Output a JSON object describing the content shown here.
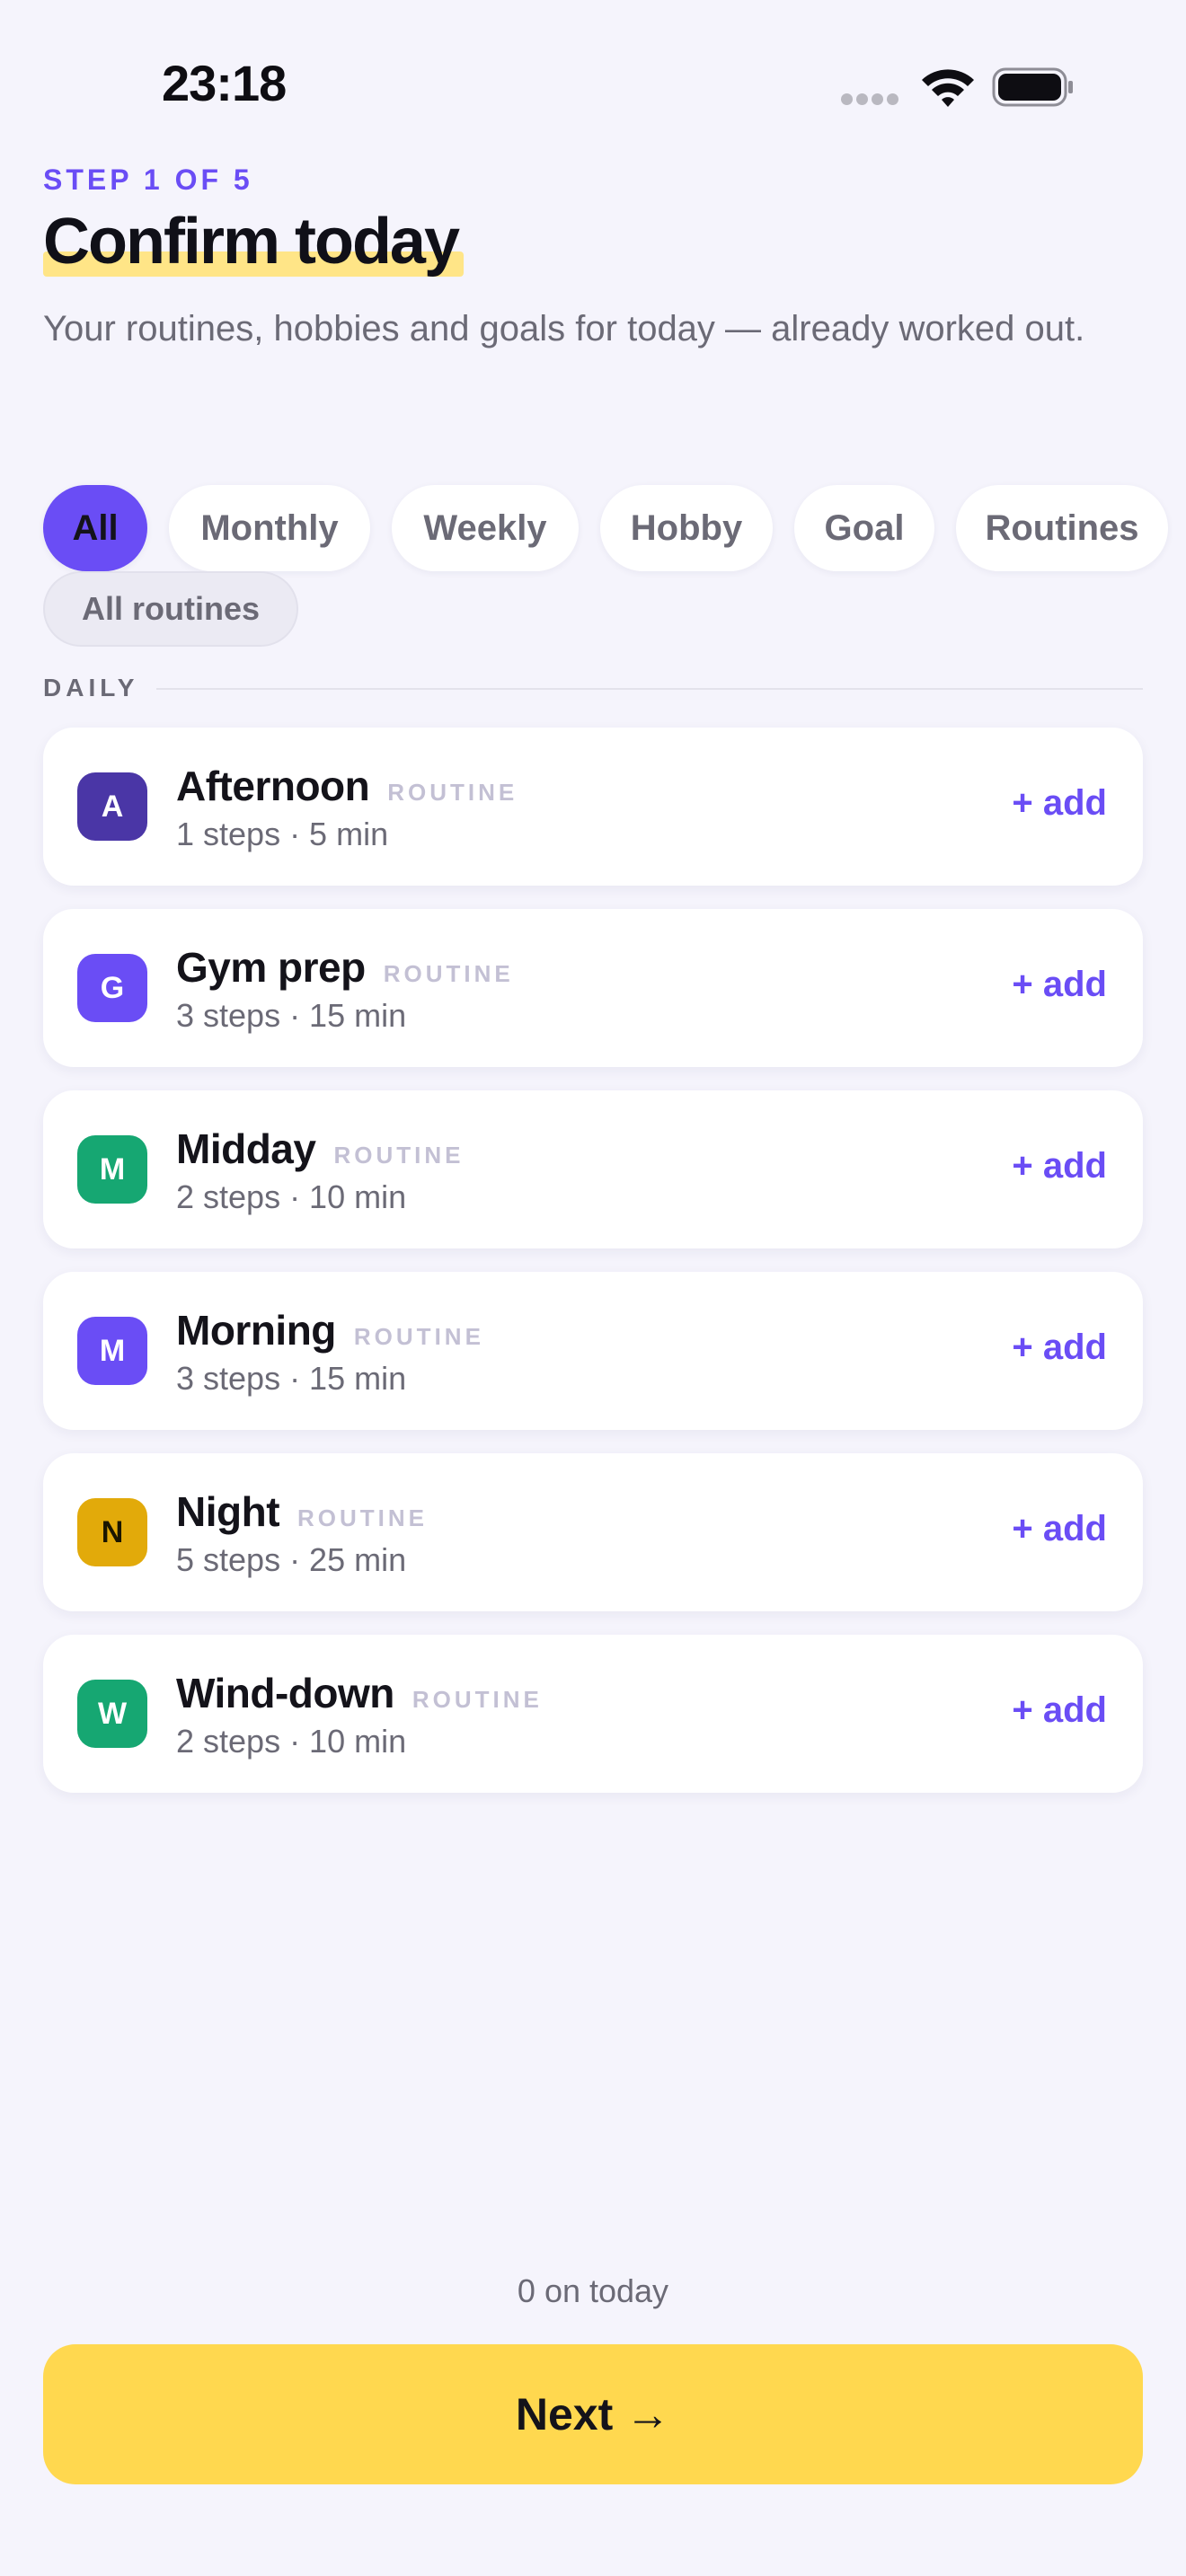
{
  "status_bar": {
    "time": "23:18"
  },
  "header": {
    "step": "STEP 1 OF 5",
    "title": "Confirm today",
    "subtitle": "Your routines, hobbies and goals for today — already worked out."
  },
  "filters": {
    "chips": [
      {
        "label": "All",
        "active": true
      },
      {
        "label": "Monthly"
      },
      {
        "label": "Weekly"
      },
      {
        "label": "Hobby"
      },
      {
        "label": "Goal"
      },
      {
        "label": "Routines"
      }
    ],
    "secondary": "All routines"
  },
  "section": {
    "label": "DAILY"
  },
  "items": [
    {
      "initial": "A",
      "name": "Afternoon",
      "tag": "ROUTINE",
      "meta": "1 steps · 5 min",
      "action": "+ add",
      "color": "#4a36a6",
      "text_color": "#ffffff"
    },
    {
      "initial": "G",
      "name": "Gym prep",
      "tag": "ROUTINE",
      "meta": "3 steps · 15 min",
      "action": "+ add",
      "color": "#6a4df5",
      "text_color": "#ffffff"
    },
    {
      "initial": "M",
      "name": "Midday",
      "tag": "ROUTINE",
      "meta": "2 steps · 10 min",
      "action": "+ add",
      "color": "#16a772",
      "text_color": "#ffffff"
    },
    {
      "initial": "M",
      "name": "Morning",
      "tag": "ROUTINE",
      "meta": "3 steps · 15 min",
      "action": "+ add",
      "color": "#6a4df5",
      "text_color": "#ffffff"
    },
    {
      "initial": "N",
      "name": "Night",
      "tag": "ROUTINE",
      "meta": "5 steps · 25 min",
      "action": "+ add",
      "color": "#e2aa0a",
      "text_color": "#1a1600"
    },
    {
      "initial": "W",
      "name": "Wind-down",
      "tag": "ROUTINE",
      "meta": "2 steps · 10 min",
      "action": "+ add",
      "color": "#16a772",
      "text_color": "#ffffff"
    }
  ],
  "footer": {
    "count": "0 on today",
    "next_label": "Next →"
  },
  "colors": {
    "accent": "#6a4df5",
    "cta": "#ffd84f",
    "background": "#f5f4fc"
  }
}
